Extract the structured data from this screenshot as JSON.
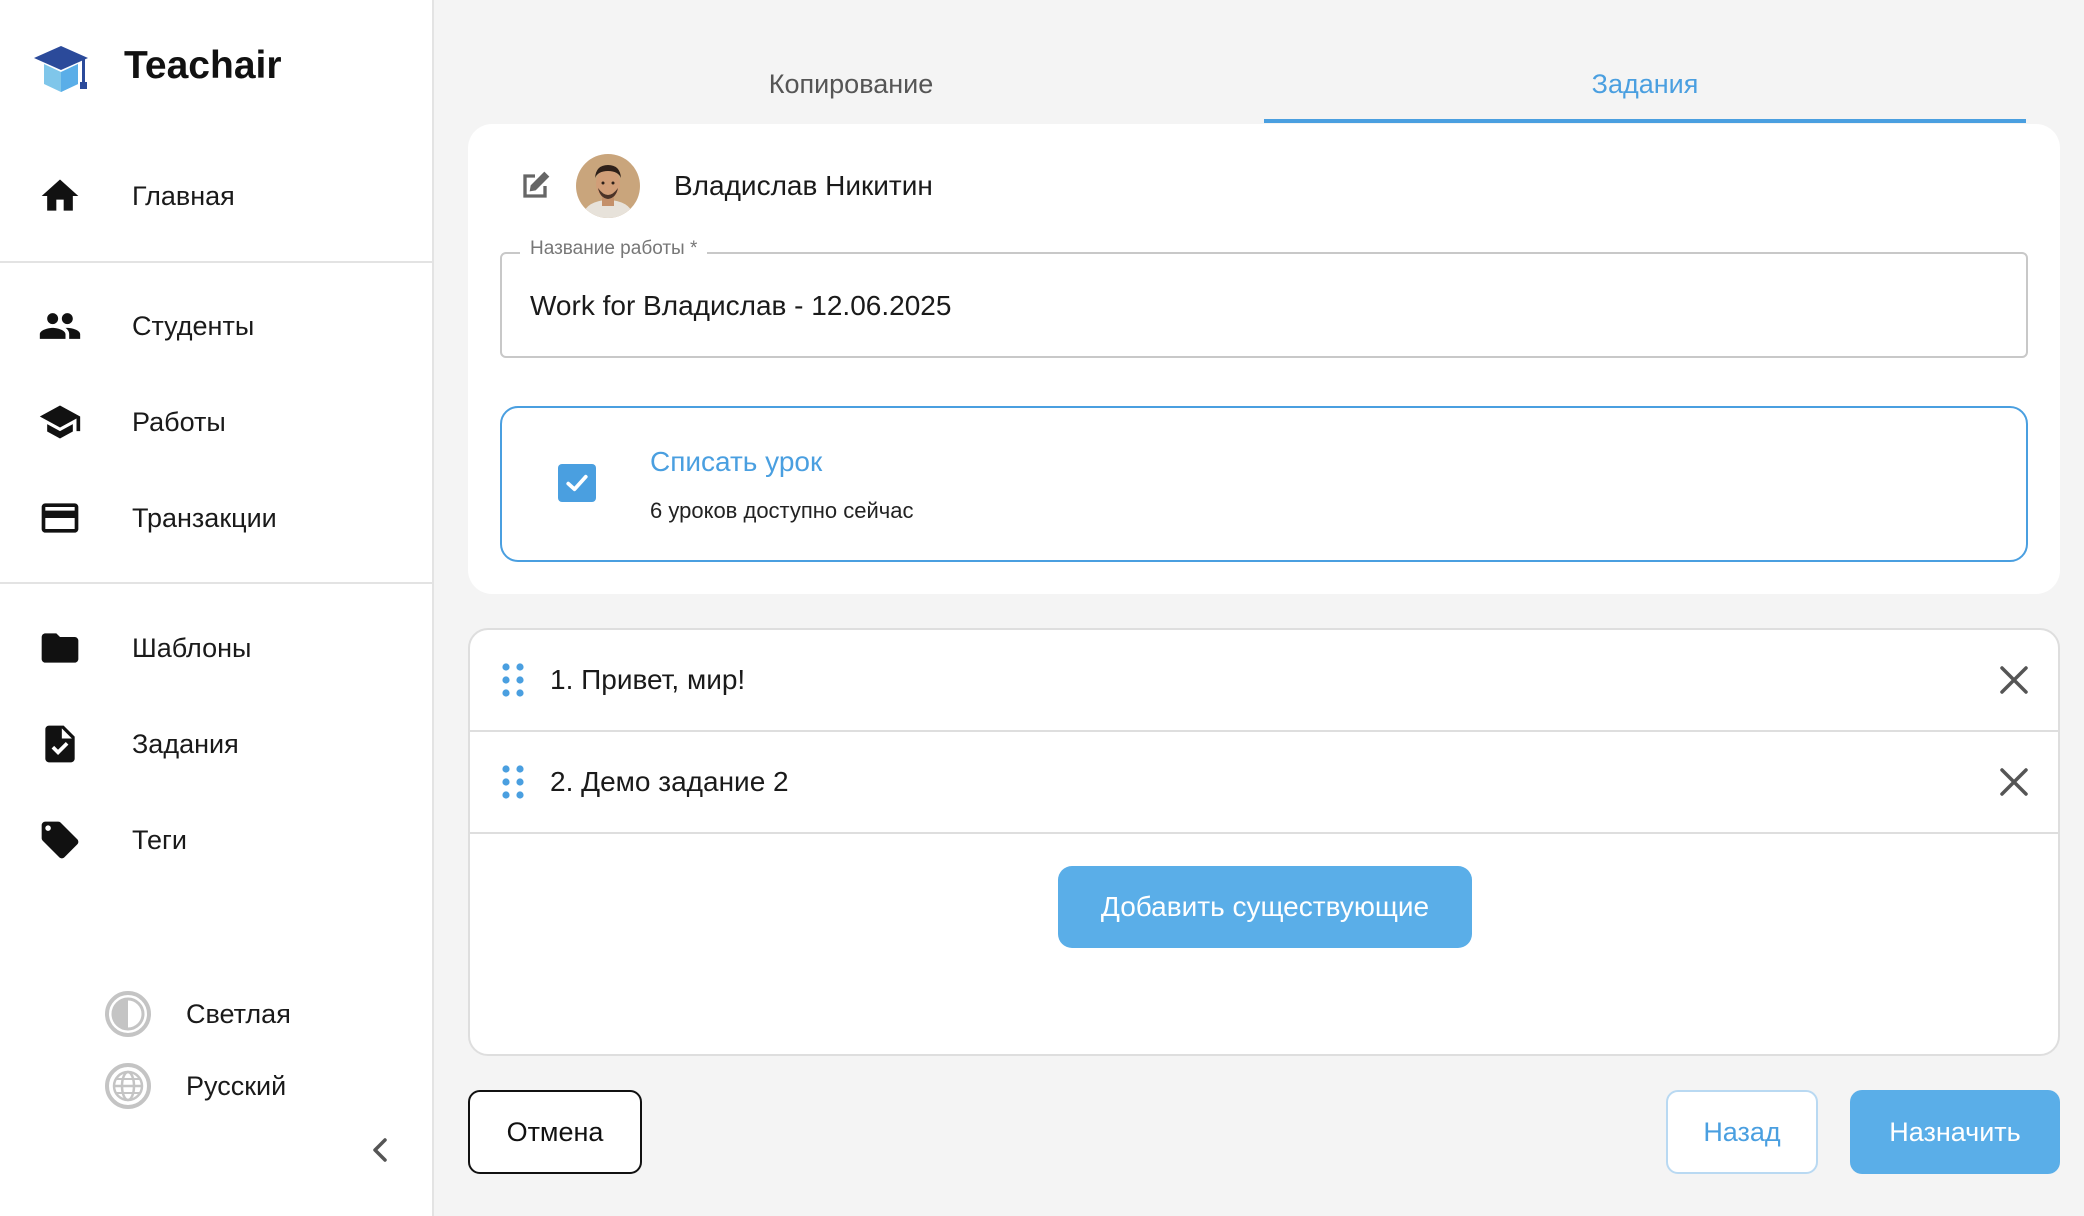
{
  "app": {
    "name": "Teachair"
  },
  "sidebar": {
    "items": [
      {
        "label": "Главная",
        "icon": "home-icon"
      },
      {
        "label": "Студенты",
        "icon": "people-icon"
      },
      {
        "label": "Работы",
        "icon": "graduation-cap-icon"
      },
      {
        "label": "Транзакции",
        "icon": "credit-card-icon"
      },
      {
        "label": "Шаблоны",
        "icon": "folder-icon"
      },
      {
        "label": "Задания",
        "icon": "task-file-icon"
      },
      {
        "label": "Теги",
        "icon": "tag-icon"
      }
    ],
    "theme_label": "Светлая",
    "language_label": "Русский"
  },
  "tabs": [
    {
      "label": "Копирование",
      "active": false
    },
    {
      "label": "Задания",
      "active": true
    }
  ],
  "student": {
    "name": "Владислав Никитин"
  },
  "form": {
    "work_name_label": "Название работы *",
    "work_name_value": "Work for Владислав - 12.06.2025"
  },
  "lesson_option": {
    "title": "Списать урок",
    "subtitle": "6 уроков доступно сейчас",
    "checked": true
  },
  "tasks": [
    {
      "label": "1. Привет, мир!"
    },
    {
      "label": "2. Демо задание 2"
    }
  ],
  "buttons": {
    "add_existing": "Добавить существующие",
    "cancel": "Отмена",
    "back": "Назад",
    "assign": "Назначить"
  },
  "colors": {
    "accent": "#4a9fe0",
    "button": "#5aaee8"
  }
}
